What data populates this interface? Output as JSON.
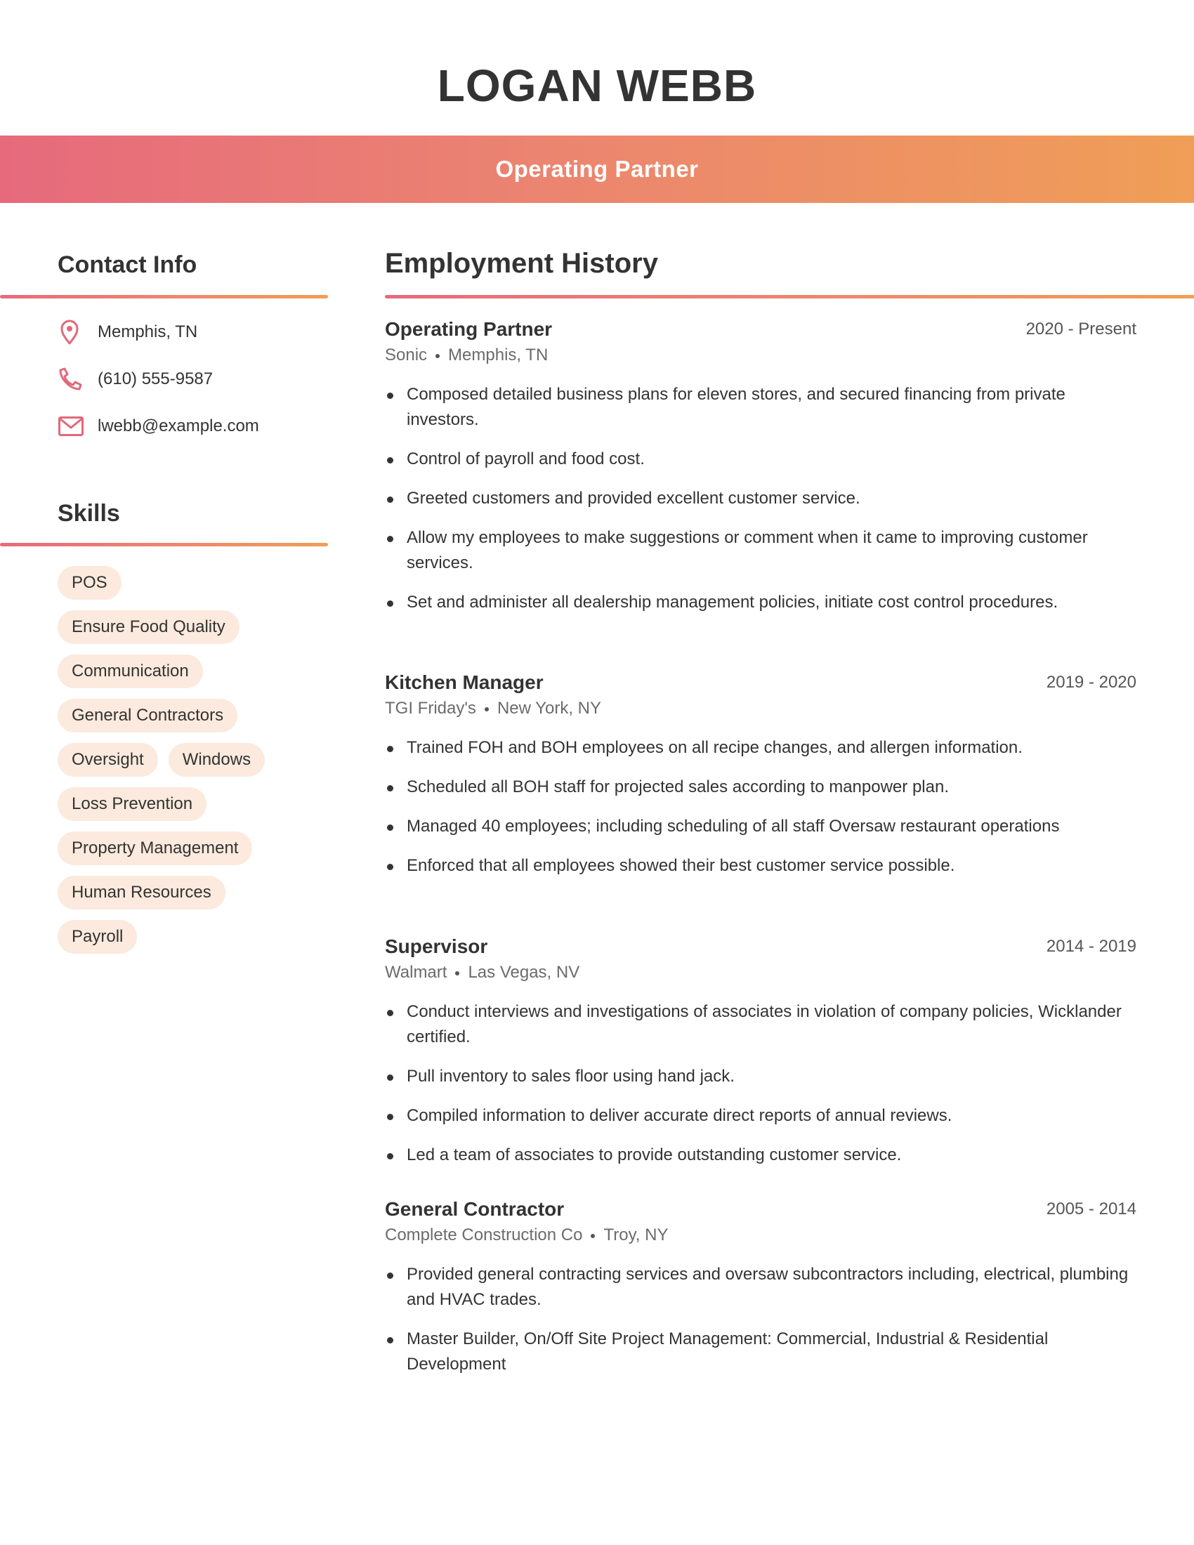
{
  "header": {
    "name": "LOGAN WEBB",
    "title": "Operating Partner"
  },
  "colors": {
    "accent_start": "#E66A7C",
    "accent_end": "#F09E57",
    "tag_background": "#FBEADD",
    "text": "#333333"
  },
  "contact": {
    "heading": "Contact Info",
    "items": [
      {
        "icon": "map-pin-icon",
        "text": "Memphis, TN"
      },
      {
        "icon": "phone-icon",
        "text": "(610) 555-9587"
      },
      {
        "icon": "email-icon",
        "text": "lwebb@example.com"
      }
    ]
  },
  "skills": {
    "heading": "Skills",
    "items": [
      "POS",
      "Ensure Food Quality",
      "Communication",
      "General Contractors",
      "Oversight",
      "Windows",
      "Loss Prevention",
      "Property Management",
      "Human Resources",
      "Payroll"
    ]
  },
  "employment": {
    "heading": "Employment History",
    "jobs": [
      {
        "title": "Operating Partner",
        "dates": "2020 - Present",
        "company": "Sonic",
        "location": "Memphis, TN",
        "bullets": [
          "Composed detailed business plans for eleven stores, and secured financing from private investors.",
          "Control of payroll and food cost.",
          "Greeted customers and provided excellent customer service.",
          "Allow my employees to make suggestions or comment when it came to improving customer services.",
          "Set and administer all dealership management policies, initiate cost control procedures."
        ]
      },
      {
        "title": "Kitchen Manager",
        "dates": "2019 - 2020",
        "company": "TGI Friday's",
        "location": "New York, NY",
        "bullets": [
          "Trained FOH and BOH employees on all recipe changes, and allergen information.",
          "Scheduled all BOH staff for projected sales according to manpower plan.",
          "Managed 40 employees; including scheduling of all staff Oversaw restaurant operations",
          "Enforced that all employees showed their best customer service possible."
        ]
      },
      {
        "title": "Supervisor",
        "dates": "2014 - 2019",
        "company": "Walmart",
        "location": "Las Vegas, NV",
        "bullets": [
          "Conduct interviews and investigations of associates in violation of company policies, Wicklander certified.",
          "Pull inventory to sales floor using hand jack.",
          "Compiled information to deliver accurate direct reports of annual reviews.",
          "Led a team of associates to provide outstanding customer service."
        ]
      },
      {
        "title": "General Contractor",
        "dates": "2005 - 2014",
        "company": "Complete Construction Co",
        "location": "Troy, NY",
        "bullets": [
          "Provided general contracting services and oversaw subcontractors including, electrical, plumbing and HVAC trades.",
          "Master Builder, On/Off Site Project Management: Commercial, Industrial & Residential Development"
        ]
      }
    ]
  }
}
